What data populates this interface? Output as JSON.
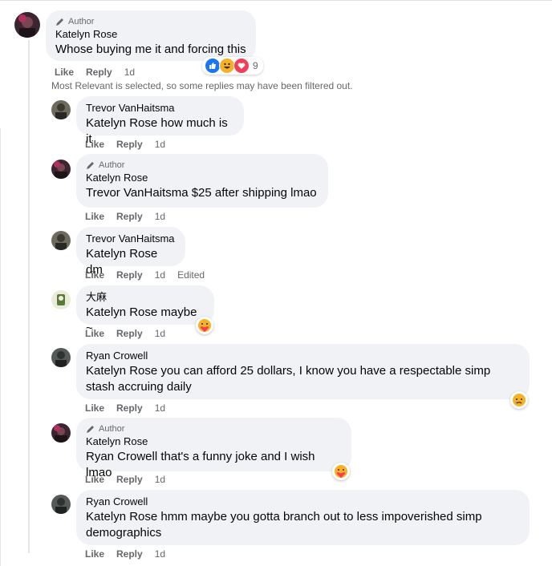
{
  "comment": {
    "author_label": "Author",
    "name": "Katelyn Rose",
    "text": "Whose buying me it and forcing this",
    "reaction_count": "9",
    "actions": {
      "like": "Like",
      "reply": "Reply",
      "time": "1d"
    }
  },
  "filter_notice": "Most Relevant is selected, so some replies may have been filtered out.",
  "replies": [
    {
      "name": "Trevor VanHaitsma",
      "tag": "Katelyn Rose",
      "text": " how much is it",
      "like": "Like",
      "reply": "Reply",
      "time": "1d"
    },
    {
      "author_label": "Author",
      "name": "Katelyn Rose",
      "tag": "Trevor VanHaitsma",
      "text": " $25 after shipping lmao",
      "like": "Like",
      "reply": "Reply",
      "time": "1d"
    },
    {
      "name": "Trevor VanHaitsma",
      "tag": "Katelyn Rose",
      "text": " dm",
      "like": "Like",
      "reply": "Reply",
      "time": "1d",
      "edited": "Edited"
    },
    {
      "name": "大麻",
      "tag": "Katelyn Rose",
      "text": " maybe ~",
      "like": "Like",
      "reply": "Reply",
      "time": "1d"
    },
    {
      "name": "Ryan Crowell",
      "tag": "Katelyn Rose",
      "text": " you can afford 25 dollars, I know you have a respectable simp stash accruing daily",
      "like": "Like",
      "reply": "Reply",
      "time": "1d"
    },
    {
      "author_label": "Author",
      "name": "Katelyn Rose",
      "tag": "Ryan Crowell",
      "text": " that's a funny joke and I wish lmao",
      "like": "Like",
      "reply": "Reply",
      "time": "1d"
    },
    {
      "name": "Ryan Crowell",
      "tag": "Katelyn Rose",
      "text": " hmm maybe you gotta branch out to less impoverished simp demographics",
      "like": "Like",
      "reply": "Reply",
      "time": "1d"
    }
  ],
  "colors": {
    "bubble": "#f0f2f5",
    "meta": "#65676b",
    "text": "#050505",
    "like_blue": "#1877f2",
    "love_red": "#f33e58",
    "haha_yellow": "#f7b125"
  }
}
